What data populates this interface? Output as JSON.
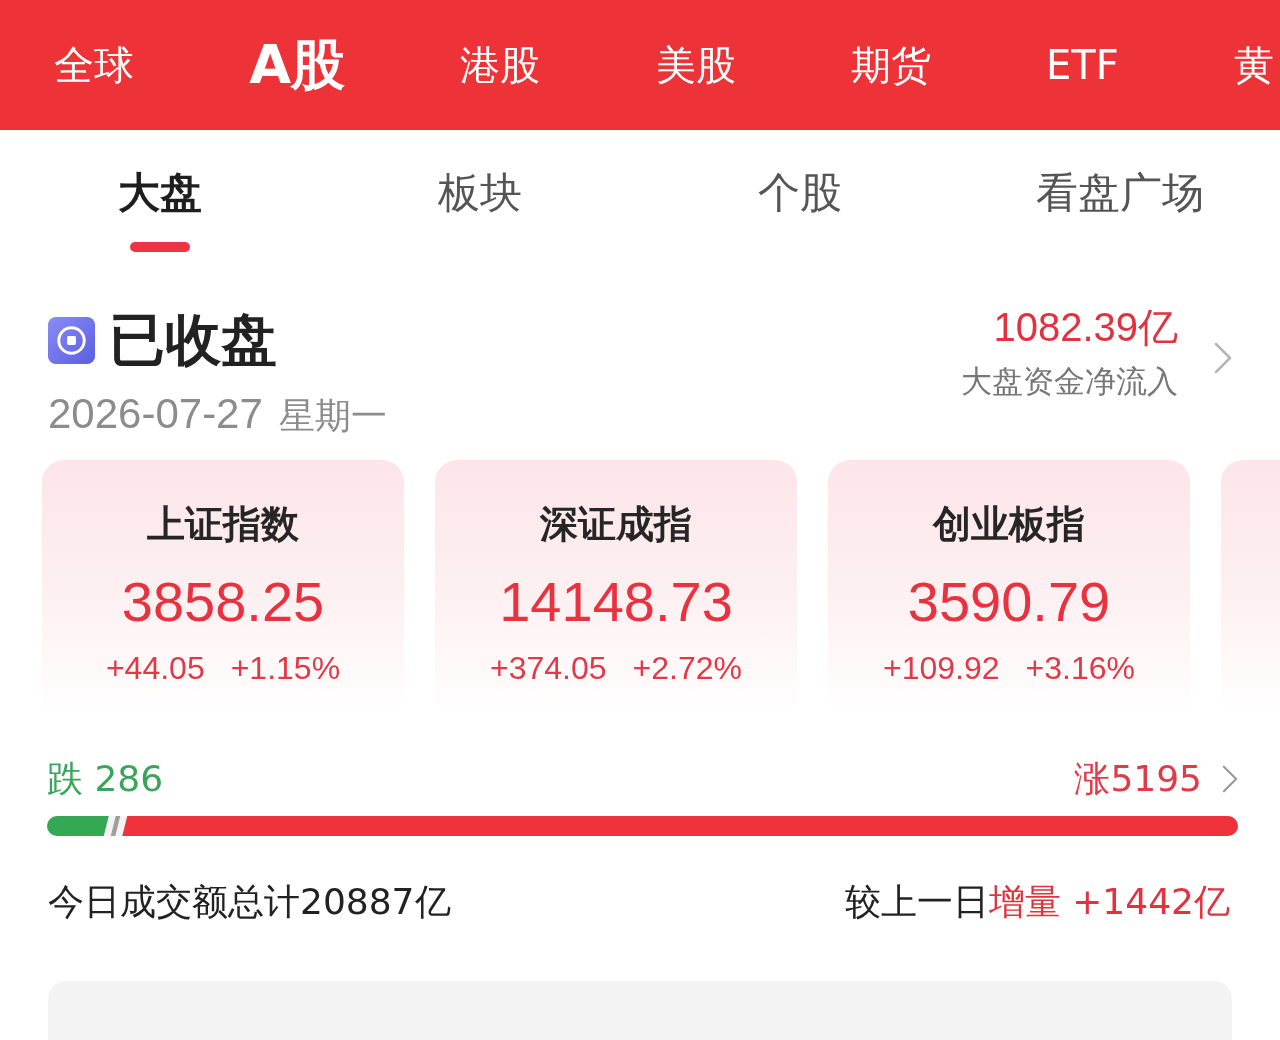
{
  "market_tabs": [
    {
      "label": "全球",
      "selected": false
    },
    {
      "label": "A股",
      "selected": true
    },
    {
      "label": "港股",
      "selected": false
    },
    {
      "label": "美股",
      "selected": false
    },
    {
      "label": "期货",
      "selected": false
    },
    {
      "label": "ETF",
      "selected": false
    },
    {
      "label": "黄",
      "selected": false
    }
  ],
  "sub_tabs": [
    {
      "label": "大盘",
      "selected": true
    },
    {
      "label": "板块",
      "selected": false
    },
    {
      "label": "个股",
      "selected": false
    },
    {
      "label": "看盘广场",
      "selected": false
    }
  ],
  "market_status": {
    "title": "已收盘",
    "date": "2026-07-27",
    "weekday": "星期一"
  },
  "fund_flow": {
    "amount": "1082.39亿",
    "label": "大盘资金净流入"
  },
  "index_cards": [
    {
      "name": "上证指数",
      "value": "3858.25",
      "change": "+44.05",
      "percent": "+1.15%"
    },
    {
      "name": "深证成指",
      "value": "14148.73",
      "change": "+374.05",
      "percent": "+2.72%"
    },
    {
      "name": "创业板指",
      "value": "3590.79",
      "change": "+109.92",
      "percent": "+3.16%"
    }
  ],
  "index_cards_more": true,
  "breadth": {
    "falling": "跌 286",
    "rising": "涨5195",
    "segments": [
      {
        "kind": "fall",
        "level": 0.052,
        "color": "#35a853"
      },
      {
        "kind": "flat",
        "level": 0.008,
        "color": "#9e9e9e"
      },
      {
        "kind": "rise",
        "level": 0.94,
        "color": "#f0323c"
      }
    ]
  },
  "turnover": {
    "total": "今日成交额总计20887亿",
    "compare_label": "较上一日",
    "compare_value": "增量 +1442亿"
  },
  "next_section": {
    "visible": true
  }
}
